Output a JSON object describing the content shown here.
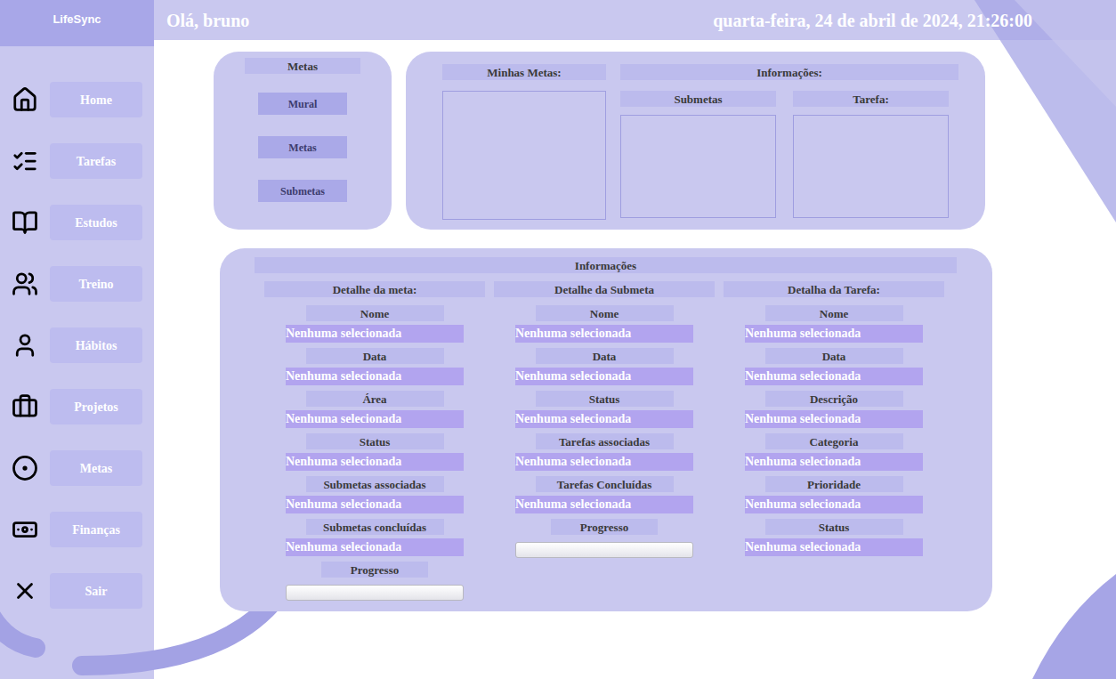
{
  "app": {
    "brand": "LifeSync"
  },
  "header": {
    "greeting": "Olá, bruno",
    "datetime": "quarta-feira, 24 de abril de 2024, 21:26:00"
  },
  "sidebar": {
    "items": [
      {
        "label": "Home"
      },
      {
        "label": "Tarefas"
      },
      {
        "label": "Estudos"
      },
      {
        "label": "Treino"
      },
      {
        "label": "Hábitos"
      },
      {
        "label": "Projetos"
      },
      {
        "label": "Metas"
      },
      {
        "label": "Finanças"
      },
      {
        "label": "Sair"
      }
    ]
  },
  "goals_menu": {
    "title": "Metas",
    "buttons": [
      "Mural",
      "Metas",
      "Submetas"
    ]
  },
  "overview": {
    "goals_title": "Minhas Metas:",
    "info_title": "Informações:",
    "subgoals_title": "Submetas",
    "task_title": "Tarefa:"
  },
  "details": {
    "title": "Informações",
    "columns": [
      {
        "title": "Detalhe da meta:",
        "fields": [
          {
            "label": "Nome",
            "value": "Nenhuma selecionada"
          },
          {
            "label": "Data",
            "value": "Nenhuma selecionada"
          },
          {
            "label": "Área",
            "value": "Nenhuma selecionada"
          },
          {
            "label": "Status",
            "value": "Nenhuma selecionada"
          },
          {
            "label": "Submetas associadas",
            "value": "Nenhuma selecionada"
          },
          {
            "label": "Submetas concluídas",
            "value": "Nenhuma selecionada"
          }
        ],
        "progress": {
          "label": "Progresso",
          "level": 0
        }
      },
      {
        "title": "Detalhe da Submeta",
        "fields": [
          {
            "label": "Nome",
            "value": "Nenhuma selecionada"
          },
          {
            "label": "Data",
            "value": "Nenhuma selecionada"
          },
          {
            "label": "Status",
            "value": "Nenhuma selecionada"
          },
          {
            "label": "Tarefas associadas",
            "value": "Nenhuma selecionada"
          },
          {
            "label": "Tarefas Concluídas",
            "value": "Nenhuma selecionada"
          }
        ],
        "progress": {
          "label": "Progresso",
          "level": 0
        }
      },
      {
        "title": "Detalha da Tarefa:",
        "fields": [
          {
            "label": "Nome",
            "value": "Nenhuma selecionada"
          },
          {
            "label": "Data",
            "value": "Nenhuma selecionada"
          },
          {
            "label": "Descrição",
            "value": "Nenhuma selecionada"
          },
          {
            "label": "Categoria",
            "value": "Nenhuma selecionada"
          },
          {
            "label": "Prioridade",
            "value": "Nenhuma selecionada"
          },
          {
            "label": "Status",
            "value": "Nenhuma selecionada"
          }
        ]
      }
    ]
  }
}
